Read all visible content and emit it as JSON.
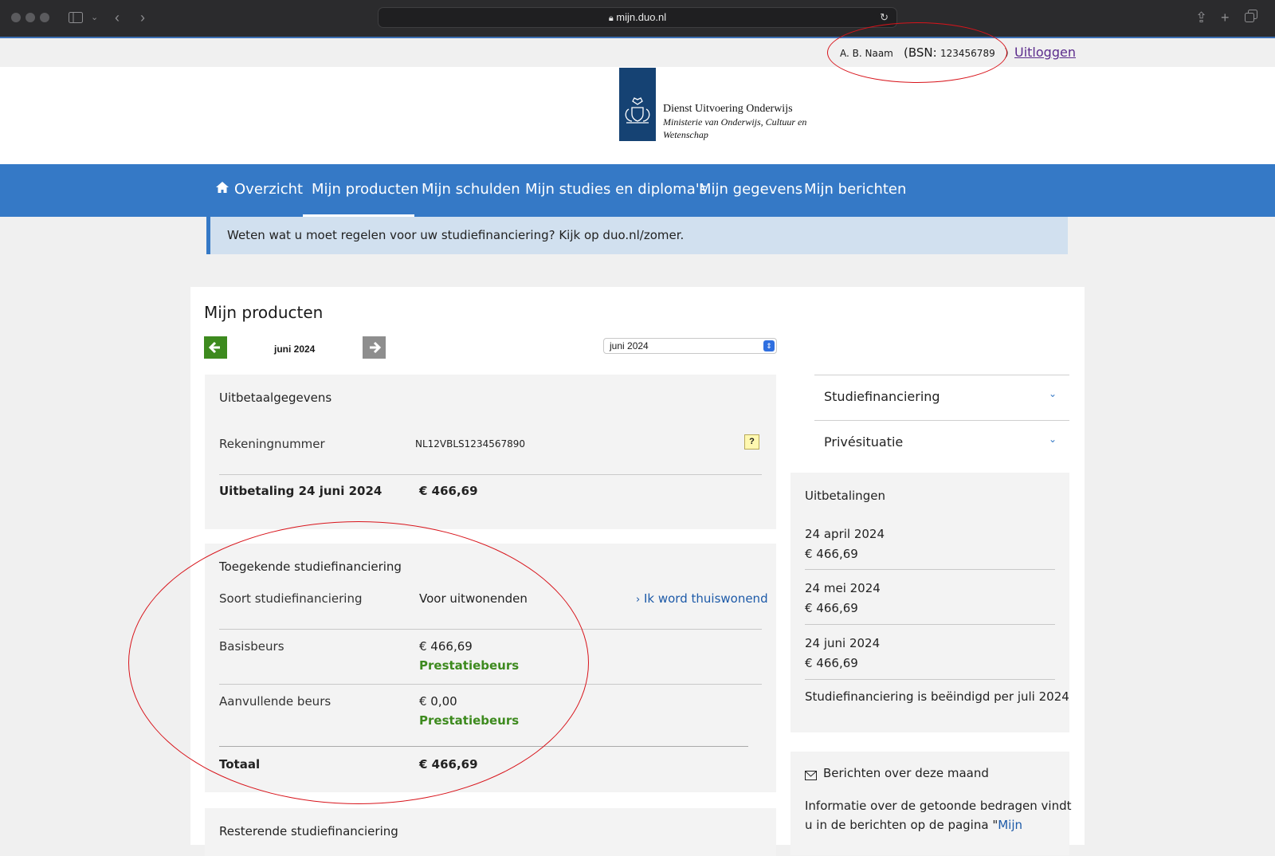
{
  "browser": {
    "url": "mijn.duo.nl"
  },
  "userbar": {
    "name": "A. B. Naam",
    "bsn_prefix": "(BSN:",
    "bsn": "123456789",
    "bsn_suffix": ")",
    "logout": "Uitloggen"
  },
  "logo": {
    "line1": "Dienst Uitvoering Onderwijs",
    "line2": "Ministerie van Onderwijs, Cultuur en",
    "line3": "Wetenschap"
  },
  "nav": {
    "items": [
      "Overzicht",
      "Mijn producten",
      "Mijn schulden",
      "Mijn studies en diploma's",
      "Mijn gegevens",
      "Mijn berichten"
    ],
    "active": "Mijn producten"
  },
  "banner": {
    "text": "Weten wat u moet regelen voor uw studiefinanciering? Kijk op duo.nl/zomer."
  },
  "page": {
    "title": "Mijn producten",
    "month_label": "juni 2024",
    "month_select": "juni 2024"
  },
  "uitbetaal": {
    "title": "Uitbetaalgegevens",
    "rekening_label": "Rekeningnummer",
    "rekening_value": "NL12VBLS1234567890",
    "help": "?",
    "uitbetaling_label": "Uitbetaling 24 juni 2024",
    "uitbetaling_value": "€ 466,69"
  },
  "toegekend": {
    "title": "Toegekende studiefinanciering",
    "soort_label": "Soort studiefinanciering",
    "soort_value": "Voor uitwonenden",
    "soort_link": "Ik word thuiswonend",
    "basis_label": "Basisbeurs",
    "basis_value": "€ 466,69",
    "basis_note": "Prestatiebeurs",
    "aanvul_label": "Aanvullende beurs",
    "aanvul_value": "€ 0,00",
    "aanvul_note": "Prestatiebeurs",
    "totaal_label": "Totaal",
    "totaal_value": "€ 466,69"
  },
  "resterend": {
    "title": "Resterende studiefinanciering"
  },
  "sidebar": {
    "acc1": "Studiefinanciering",
    "acc2": "Privésituatie",
    "uitbetalingen_title": "Uitbetalingen",
    "payments": [
      {
        "date": "24 april 2024",
        "amount": "€ 466,69"
      },
      {
        "date": "24 mei 2024",
        "amount": "€ 466,69"
      },
      {
        "date": "24 juni 2024",
        "amount": "€ 466,69"
      }
    ],
    "ended": "Studiefinanciering is beëindigd per juli 2024",
    "berichten_title": "Berichten over deze maand",
    "berichten_text1": "Informatie over de getoonde bedragen vindt",
    "berichten_text2": "u in de berichten op de pagina \"",
    "berichten_link": "Mijn"
  },
  "colors": {
    "brand_blue": "#3579c6",
    "dark_blue": "#154273",
    "green": "#3d8a1e",
    "annotation_red": "#d8141b"
  }
}
